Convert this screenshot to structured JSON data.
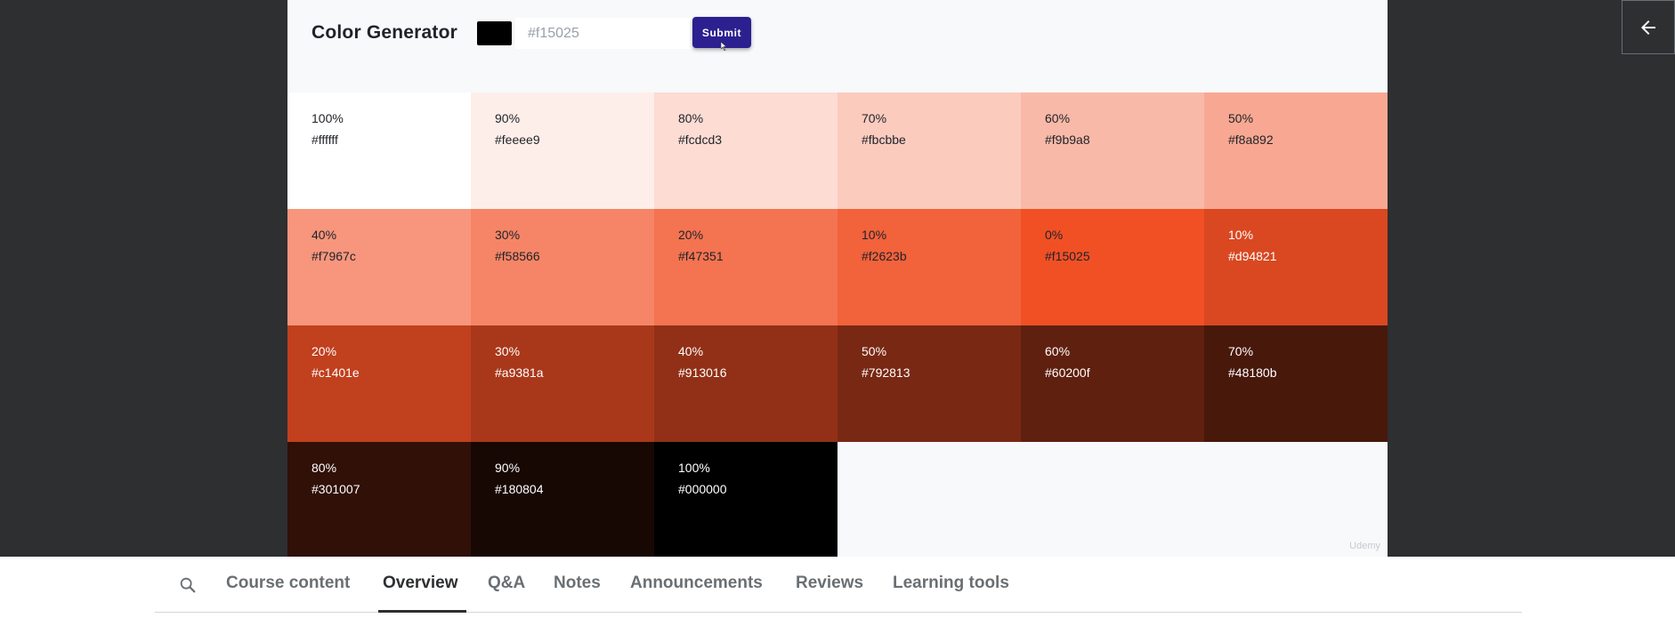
{
  "app": {
    "title": "Color Generator",
    "input_placeholder": "#f15025",
    "swatch_color": "#000000",
    "submit_label": "Submit",
    "watermark": "Udemy"
  },
  "swatches": [
    {
      "pct": "100%",
      "hex": "#ffffff",
      "text_color": "#1f2229"
    },
    {
      "pct": "90%",
      "hex": "#feeee9",
      "text_color": "#1f2229"
    },
    {
      "pct": "80%",
      "hex": "#fcdcd3",
      "text_color": "#1f2229"
    },
    {
      "pct": "70%",
      "hex": "#fbcbbe",
      "text_color": "#1f2229"
    },
    {
      "pct": "60%",
      "hex": "#f9b9a8",
      "text_color": "#1f2229"
    },
    {
      "pct": "50%",
      "hex": "#f8a892",
      "text_color": "#1f2229"
    },
    {
      "pct": "40%",
      "hex": "#f7967c",
      "text_color": "#1f2229"
    },
    {
      "pct": "30%",
      "hex": "#f58566",
      "text_color": "#1f2229"
    },
    {
      "pct": "20%",
      "hex": "#f47351",
      "text_color": "#1f2229"
    },
    {
      "pct": "10%",
      "hex": "#f2623b",
      "text_color": "#1f2229"
    },
    {
      "pct": "0%",
      "hex": "#f15025",
      "text_color": "#1f2229"
    },
    {
      "pct": "10%",
      "hex": "#d94821",
      "text_color": "#ffffff"
    },
    {
      "pct": "20%",
      "hex": "#c1401e",
      "text_color": "#ffffff"
    },
    {
      "pct": "30%",
      "hex": "#a9381a",
      "text_color": "#ffffff"
    },
    {
      "pct": "40%",
      "hex": "#913016",
      "text_color": "#ffffff"
    },
    {
      "pct": "50%",
      "hex": "#792813",
      "text_color": "#ffffff"
    },
    {
      "pct": "60%",
      "hex": "#60200f",
      "text_color": "#ffffff"
    },
    {
      "pct": "70%",
      "hex": "#48180b",
      "text_color": "#ffffff"
    },
    {
      "pct": "80%",
      "hex": "#301007",
      "text_color": "#ffffff"
    },
    {
      "pct": "90%",
      "hex": "#180804",
      "text_color": "#ffffff"
    },
    {
      "pct": "100%",
      "hex": "#000000",
      "text_color": "#ffffff"
    }
  ],
  "tabs": {
    "search_icon": "search-icon",
    "items": [
      {
        "label": "Course content",
        "active": false
      },
      {
        "label": "Overview",
        "active": true
      },
      {
        "label": "Q&A",
        "active": false
      },
      {
        "label": "Notes",
        "active": false
      },
      {
        "label": "Announcements",
        "active": false
      },
      {
        "label": "Reviews",
        "active": false
      },
      {
        "label": "Learning tools",
        "active": false
      }
    ]
  },
  "back_button_icon": "arrow-left-icon"
}
